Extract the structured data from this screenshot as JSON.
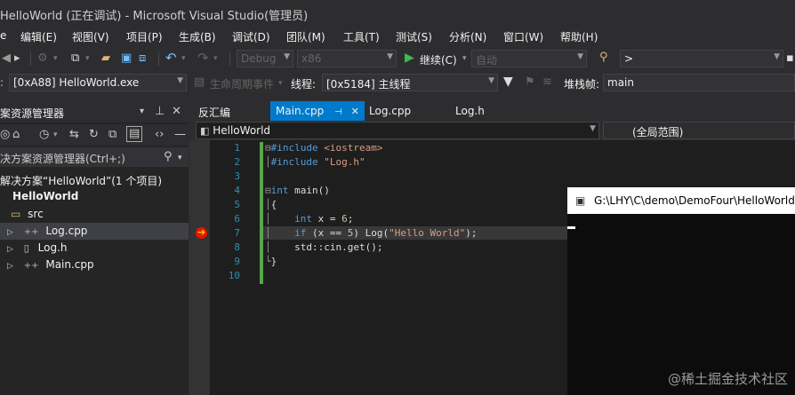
{
  "window": {
    "title": "HelloWorld (正在调试) - Microsoft Visual Studio(管理员)"
  },
  "menu": [
    "编辑(E)",
    "视图(V)",
    "项目(P)",
    "生成(B)",
    "调试(D)",
    "团队(M)",
    "工具(T)",
    "测试(S)",
    "分析(N)",
    "窗口(W)",
    "帮助(H)"
  ],
  "toolbar": {
    "config": "Debug",
    "platform": "x86",
    "continue_label": "继续(C)",
    "auto": "自动",
    "find_value": ">"
  },
  "debugbar": {
    "process": "[0xA88] HelloWorld.exe",
    "lifecycle_label": "生命周期事件",
    "thread_label": "线程:",
    "thread_value": "[0x5184] 主线程",
    "stack_label": "堆栈帧:",
    "stack_value": "main"
  },
  "solution_explorer": {
    "title": "案资源管理器",
    "search_placeholder": "决方案资源管理器(Ctrl+;)",
    "solution_node": "解决方案“HelloWorld”(1 个项目)",
    "project": "HelloWorld",
    "folder": "src",
    "files": [
      "Log.cpp",
      "Log.h",
      "Main.cpp"
    ]
  },
  "tabs": {
    "disasm": "反汇编",
    "main": "Main.cpp",
    "log_cpp": "Log.cpp",
    "log_h": "Log.h"
  },
  "editor": {
    "scope": "HelloWorld",
    "member_scope": "(全局范围)",
    "line_numbers": [
      "1",
      "2",
      "3",
      "4",
      "5",
      "6",
      "7",
      "8",
      "9",
      "10"
    ]
  },
  "console": {
    "title": "G:\\LHY\\C\\demo\\DemoFour\\HelloWorld\\"
  },
  "watermark": "@稀土掘金技术社区",
  "colors": {
    "accent": "#007acc",
    "background": "#2d2d30",
    "editor": "#1e1e1e",
    "breakpoint": "#e51400",
    "arrow": "#ffcc00"
  }
}
